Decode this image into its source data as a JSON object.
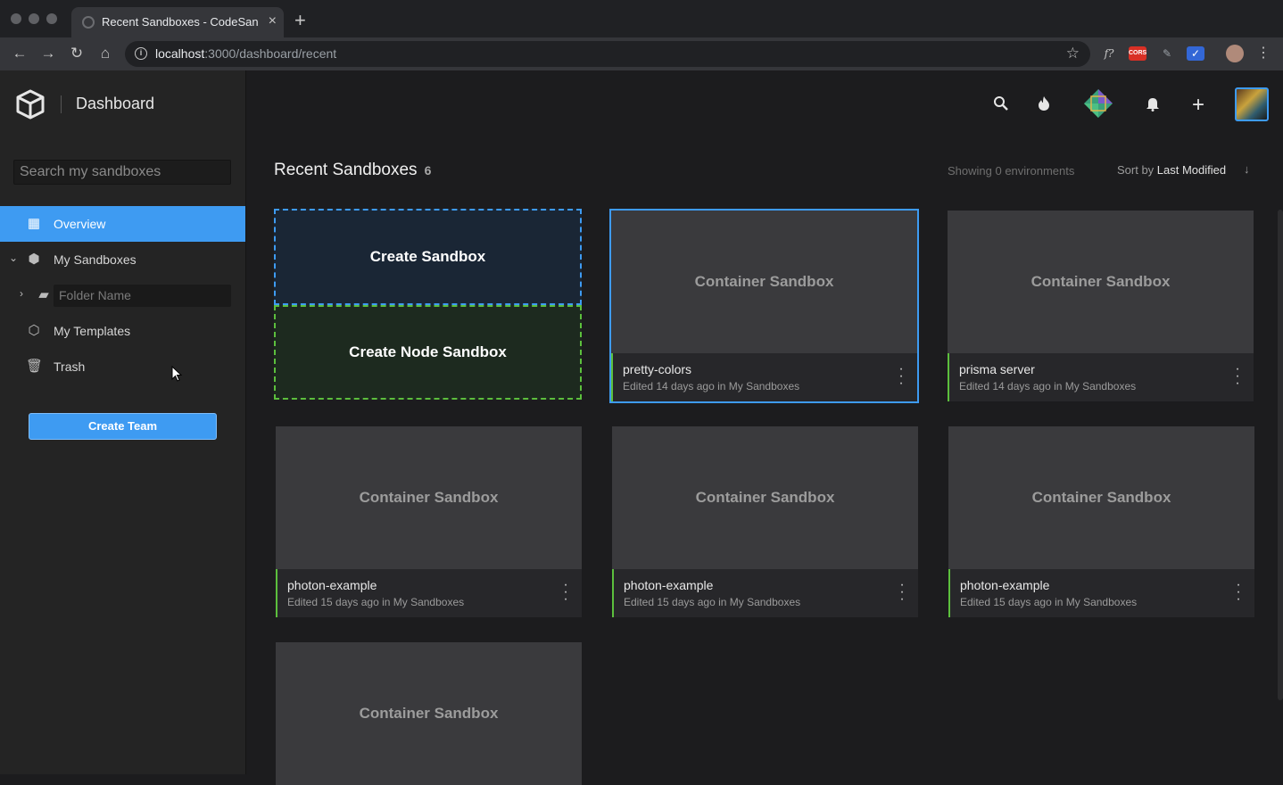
{
  "browser": {
    "tab_title": "Recent Sandboxes - CodeSandbox",
    "url_host": "localhost",
    "url_path": ":3000/dashboard/recent",
    "ext_cors": "CORS",
    "ext_fx": "f?"
  },
  "sidebar": {
    "title": "Dashboard",
    "search_placeholder": "Search my sandboxes",
    "items": [
      {
        "label": "Overview"
      },
      {
        "label": "My Sandboxes"
      },
      {
        "label": "Folder Name"
      },
      {
        "label": "My Templates"
      },
      {
        "label": "Trash"
      }
    ],
    "create_team": "Create Team"
  },
  "main": {
    "heading": "Recent Sandboxes",
    "count": "6",
    "showing": "Showing 0 environments",
    "sort_prefix": "Sort by ",
    "sort_value": "Last Modified",
    "create_sandbox": "Create Sandbox",
    "create_node_sandbox": "Create Node Sandbox",
    "cards": [
      {
        "thumb": "Container Sandbox",
        "name": "pretty-colors",
        "edited": "Edited 14 days ago in My Sandboxes"
      },
      {
        "thumb": "Container Sandbox",
        "name": "prisma server",
        "edited": "Edited 14 days ago in My Sandboxes"
      },
      {
        "thumb": "Container Sandbox",
        "name": "photon-example",
        "edited": "Edited 15 days ago in My Sandboxes"
      },
      {
        "thumb": "Container Sandbox",
        "name": "photon-example",
        "edited": "Edited 15 days ago in My Sandboxes"
      },
      {
        "thumb": "Container Sandbox",
        "name": "photon-example",
        "edited": "Edited 15 days ago in My Sandboxes"
      },
      {
        "thumb": "Container Sandbox",
        "name": "",
        "edited": ""
      }
    ]
  },
  "colors": {
    "accent": "#3e9bf2",
    "green": "#5cbf3d",
    "background": "#1c1c1e",
    "sidebar": "#242424"
  },
  "icons": [
    "search-icon",
    "flame-icon",
    "diamond-logo-icon",
    "bell-icon",
    "plus-icon",
    "avatar",
    "kebab-icon"
  ]
}
